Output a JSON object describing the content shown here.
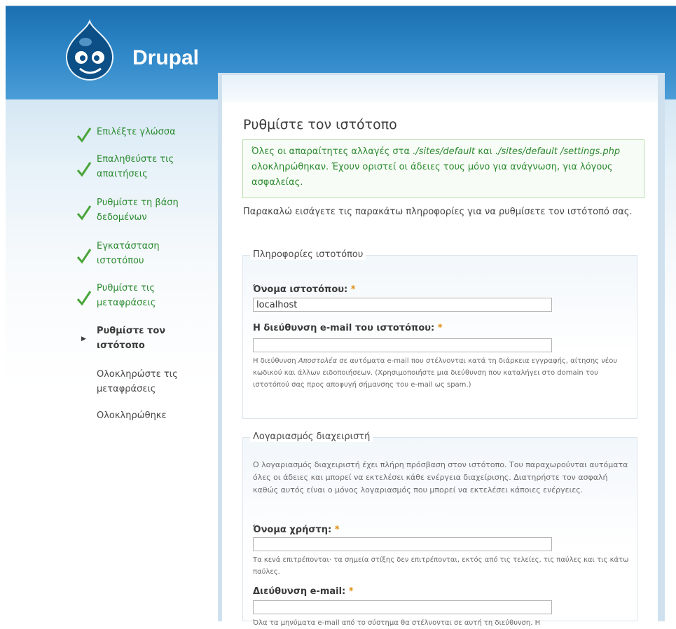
{
  "site": {
    "name": "Drupal"
  },
  "steps": [
    {
      "label": "Επιλέξτε γλώσσα",
      "state": "done"
    },
    {
      "label": "Επαληθεύστε τις απαιτήσεις",
      "state": "done"
    },
    {
      "label": "Ρυθμίστε τη βάση δεδομένων",
      "state": "done"
    },
    {
      "label": "Εγκατάσταση ιστοτόπου",
      "state": "done"
    },
    {
      "label": "Ρυθμίστε τις μεταφράσεις",
      "state": "done"
    },
    {
      "label": "Ρυθμίστε τον ιστότοπο",
      "state": "active"
    },
    {
      "label": "Ολοκληρώστε τις μεταφράσεις",
      "state": "pending"
    },
    {
      "label": "Ολοκληρώθηκε",
      "state": "pending"
    }
  ],
  "page": {
    "title": "Ρυθμίστε τον ιστότοπο",
    "status": {
      "p1": "Όλες οι απαραίτητες αλλαγές στα ",
      "path1": "./sites/default",
      "p2": " και ",
      "path2": "./sites/default /settings.php",
      "p3": " ολοκληρώθηκαν. Έχουν οριστεί οι άδειες τους μόνο για ανάγνωση, για λόγους ασφαλείας."
    },
    "intro": "Παρακαλώ εισάγετε τις παρακάτω πληροφορίες για να ρυθμίσετε τον ιστότοπό σας."
  },
  "site_info": {
    "legend": "Πληροφορίες ιστοτόπου",
    "site_name_label": "Όνομα ιστοτόπου:",
    "site_name_value": "localhost",
    "site_mail_label": "Η διεύθυνση e-mail του ιστοτόπου:",
    "site_mail_value": "",
    "site_mail_desc_a": "Η διεύθυνση ",
    "site_mail_desc_em": "Αποστολέα",
    "site_mail_desc_b": " σε αυτόματα e-mail που στέλνονται κατά τη διάρκεια εγγραφής, αίτησης νέου κωδικού και άλλων ειδοποιήσεων. (Χρησιμοποιήστε μια διεύθυνση που καταλήγει στο domain του ιστοτόπού σας προς αποφυγή σήμανσης του e-mail ως spam.)"
  },
  "admin_account": {
    "legend": "Λογαριασμός διαχειριστή",
    "desc": "Ο λογαριασμός διαχειριστή έχει πλήρη πρόσβαση στον ιστότοπο. Του παραχωρούνται αυτόματα όλες οι άδειες και μπορεί να εκτελέσει κάθε ενέργεια διαχείρισης. Διατηρήστε τον ασφαλή καθώς αυτός είναι ο μόνος λογαριασμός που μπορεί να εκτελέσει κάποιες ενέργειες.",
    "username_label": "Όνομα χρήστη:",
    "username_value": "",
    "username_desc": "Τα κενά επιτρέπονται· τα σημεία στίξης δεν επιτρέπονται, εκτός από τις τελείες, τις παύλες και τις κάτω παύλες.",
    "email_label": "Διεύθυνση e-mail:",
    "email_value": "",
    "email_desc": "Όλα τα μηνύματα e-mail από το σύστημα θα στέλνονται σε αυτή τη διεύθυνση. Η"
  },
  "required_marker": "*",
  "colors": {
    "header": "#2c85c6",
    "done": "#2a8a2f",
    "required": "#e09010"
  }
}
